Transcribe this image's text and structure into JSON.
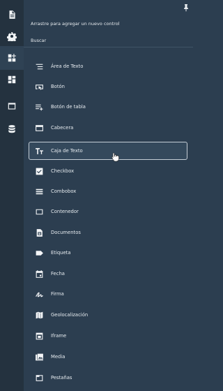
{
  "panel": {
    "hint": "Arrastre para agregar un nuevo control",
    "search_placeholder": "Buscar"
  },
  "rail": [
    {
      "icon": "document-icon"
    },
    {
      "icon": "gear-icon"
    },
    {
      "icon": "add-widget-icon",
      "active": true
    },
    {
      "icon": "dashboard-icon"
    },
    {
      "icon": "window-icon"
    },
    {
      "icon": "database-icon"
    }
  ],
  "controls": [
    {
      "label": "Área de Texto",
      "icon": "text-lines-icon"
    },
    {
      "label": "Botón",
      "icon": "button-icon"
    },
    {
      "label": "Botón de tabla",
      "icon": "table-button-icon"
    },
    {
      "label": "Cabecera",
      "icon": "header-icon"
    },
    {
      "label": "Caja de Texto",
      "icon": "text-box-icon",
      "highlighted": true
    },
    {
      "label": "Checkbox",
      "icon": "checkbox-icon"
    },
    {
      "label": "Combobox",
      "icon": "combobox-icon"
    },
    {
      "label": "Contenedor",
      "icon": "container-icon"
    },
    {
      "label": "Documentos",
      "icon": "documents-icon"
    },
    {
      "label": "Etiqueta",
      "icon": "label-icon"
    },
    {
      "label": "Fecha",
      "icon": "calendar-icon"
    },
    {
      "label": "Firma",
      "icon": "signature-icon"
    },
    {
      "label": "Geolocalización",
      "icon": "map-icon"
    },
    {
      "label": "Iframe",
      "icon": "iframe-icon"
    },
    {
      "label": "Media",
      "icon": "media-icon"
    },
    {
      "label": "Pestañas",
      "icon": "tabs-icon"
    }
  ]
}
